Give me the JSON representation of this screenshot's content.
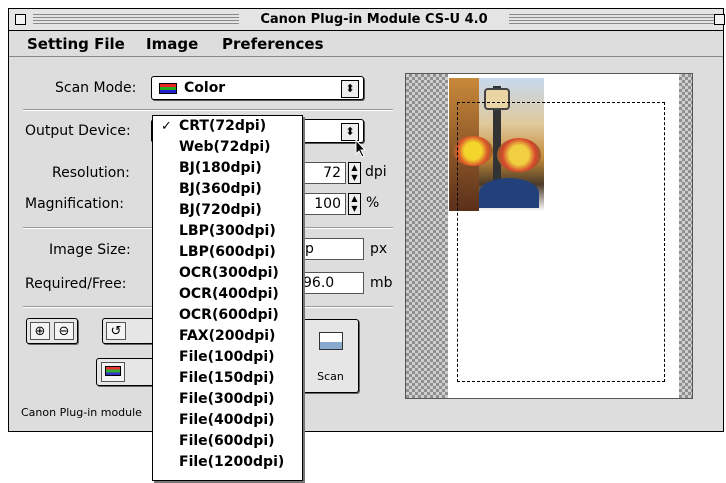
{
  "window": {
    "title": "Canon Plug-in Module CS-U 4.0"
  },
  "menubar": {
    "items": [
      "Setting File",
      "Image",
      "Preferences"
    ]
  },
  "scan_mode": {
    "label": "Scan Mode:",
    "value": "Color"
  },
  "output_device": {
    "label": "Output Device:"
  },
  "resolution": {
    "label": "Resolution:",
    "value": "72",
    "unit": "dpi"
  },
  "magnification": {
    "label": "Magnification:",
    "value": "100",
    "unit": "%"
  },
  "image_size": {
    "label": "Image Size:",
    "value_fragment": "p",
    "unit": "px"
  },
  "required_free": {
    "label": "Required/Free:",
    "value_fragment": "96.0",
    "unit": "mb"
  },
  "scan_button": {
    "label": "Scan"
  },
  "status": {
    "text": "Canon Plug-in module"
  },
  "dropdown": {
    "checked_index": 0,
    "check_mark": "✓",
    "items": [
      "CRT(72dpi)",
      "Web(72dpi)",
      "BJ(180dpi)",
      "BJ(360dpi)",
      "BJ(720dpi)",
      "LBP(300dpi)",
      "LBP(600dpi)",
      "OCR(300dpi)",
      "OCR(400dpi)",
      "OCR(600dpi)",
      "FAX(200dpi)",
      "File(100dpi)",
      "File(150dpi)",
      "File(300dpi)",
      "File(400dpi)",
      "File(600dpi)",
      "File(1200dpi)"
    ]
  },
  "icons": {
    "color_swatch": "color-swatch-icon",
    "zoom_in": "zoom-in-icon",
    "zoom_out": "zoom-out-icon",
    "rotate": "rotate-icon",
    "monitor": "monitor-icon",
    "scan": "scan-icon"
  }
}
